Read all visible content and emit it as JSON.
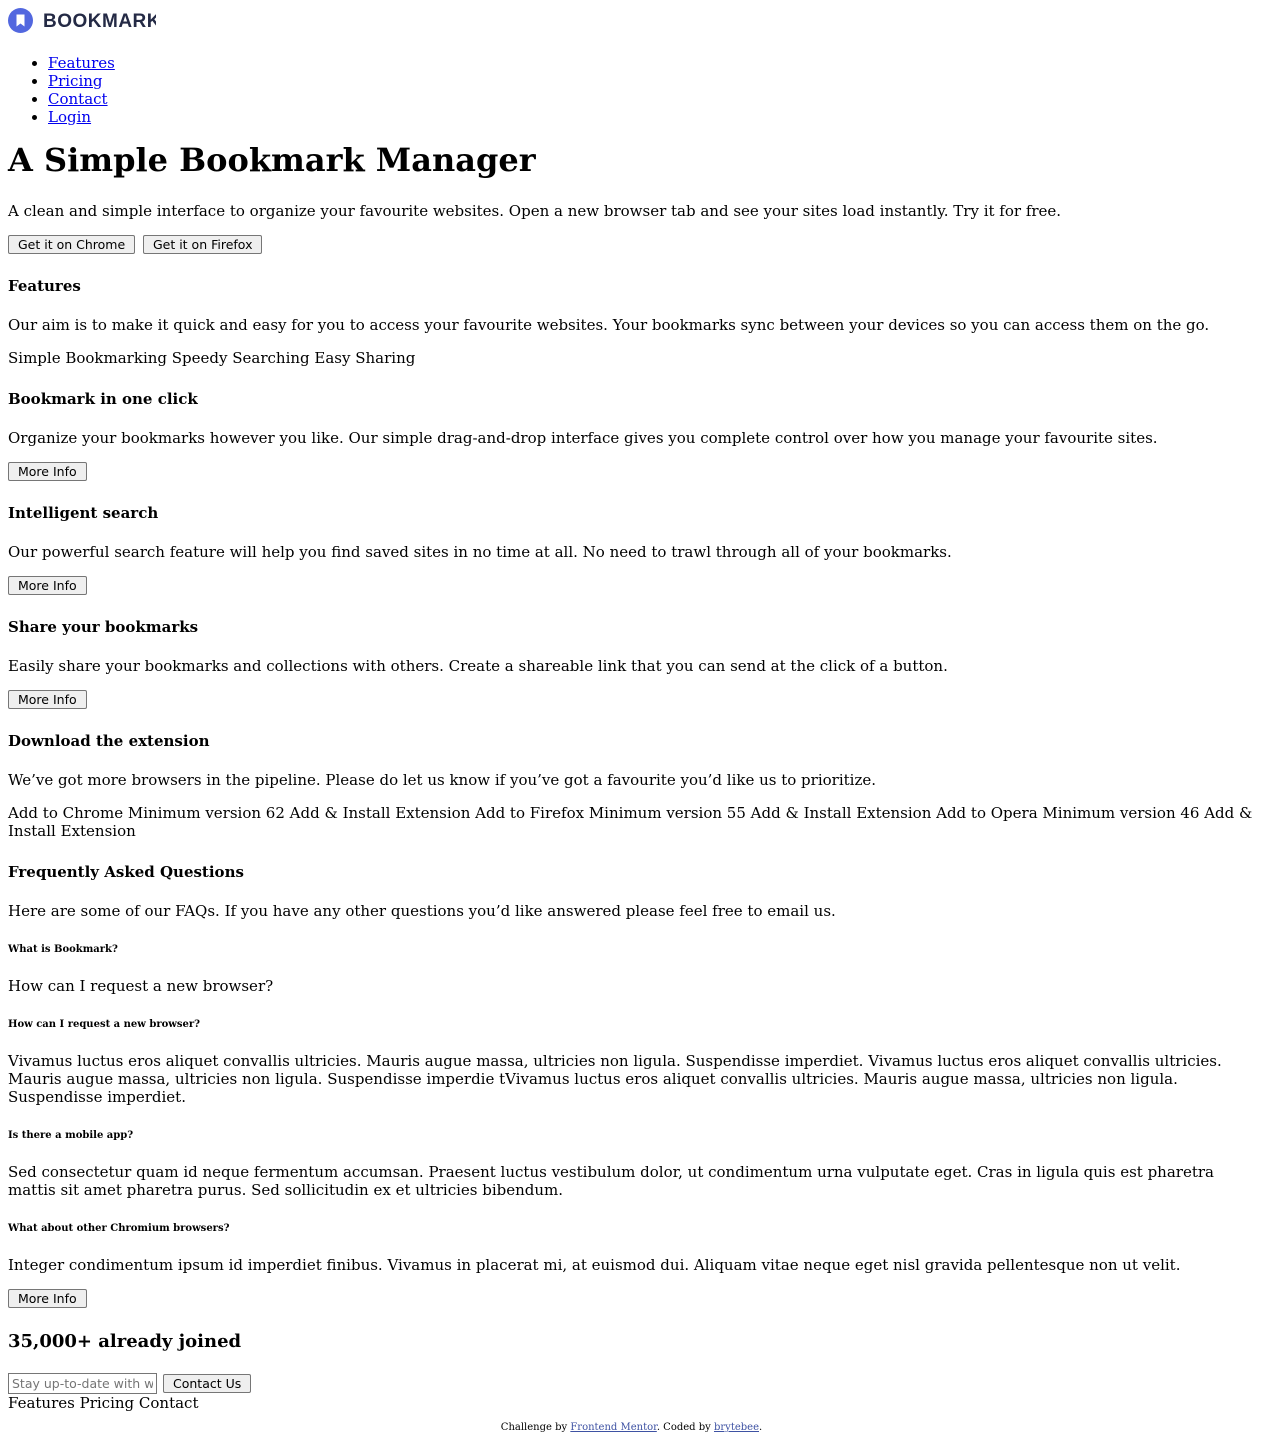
{
  "brand": {
    "name": "BOOKMARK",
    "color": "#5267df",
    "text_color": "#242a45"
  },
  "nav": {
    "items": [
      "Features",
      "Pricing",
      "Contact",
      "Login"
    ]
  },
  "hero": {
    "title": "A Simple Bookmark Manager",
    "text": "A clean and simple interface to organize your favourite websites. Open a new browser tab and see your sites load instantly. Try it for free.",
    "chrome_button": "Get it on Chrome",
    "firefox_button": "Get it on Firefox"
  },
  "features": {
    "title": "Features",
    "text": "Our aim is to make it quick and easy for you to access your favourite websites. Your bookmarks sync between your devices so you can access them on the go.",
    "tabs_line": "Simple Bookmarking Speedy Searching Easy Sharing",
    "items": [
      {
        "title": "Bookmark in one click",
        "text": "Organize your bookmarks however you like. Our simple drag-and-drop interface gives you complete control over how you manage your favourite sites.",
        "button": "More Info"
      },
      {
        "title": "Intelligent search",
        "text": "Our powerful search feature will help you find saved sites in no time at all. No need to trawl through all of your bookmarks.",
        "button": "More Info"
      },
      {
        "title": "Share your bookmarks",
        "text": "Easily share your bookmarks and collections with others. Create a shareable link that you can send at the click of a button.",
        "button": "More Info"
      }
    ]
  },
  "download": {
    "title": "Download the extension",
    "text": "We’ve got more browsers in the pipeline. Please do let us know if you’ve got a favourite you’d like us to prioritize.",
    "line": "Add to Chrome Minimum version 62 Add & Install Extension Add to Firefox Minimum version 55 Add & Install Extension Add to Opera Minimum version 46 Add & Install Extension"
  },
  "faq": {
    "title": "Frequently Asked Questions",
    "text": "Here are some of our FAQs. If you have any other questions you’d like answered please feel free to email us.",
    "q1": "What is Bookmark?",
    "p1": "How can I request a new browser?",
    "q2": "How can I request a new browser?",
    "p2": "Vivamus luctus eros aliquet convallis ultricies. Mauris augue massa, ultricies non ligula. Suspendisse imperdiet. Vivamus luctus eros aliquet convallis ultricies. Mauris augue massa, ultricies non ligula. Suspendisse imperdie tVivamus luctus eros aliquet convallis ultricies. Mauris augue massa, ultricies non ligula. Suspendisse imperdiet.",
    "q3": "Is there a mobile app?",
    "p3": "Sed consectetur quam id neque fermentum accumsan. Praesent luctus vestibulum dolor, ut condimentum urna vulputate eget. Cras in ligula quis est pharetra mattis sit amet pharetra purus. Sed sollicitudin ex et ultricies bibendum.",
    "q4": "What about other Chromium browsers?",
    "p4": "Integer condimentum ipsum id imperdiet finibus. Vivamus in placerat mi, at euismod dui. Aliquam vitae neque eget nisl gravida pellentesque non ut velit.",
    "button": "More Info"
  },
  "signup": {
    "title": "35,000+ already joined",
    "placeholder": "Stay up-to-date with what we're doing",
    "button": "Contact Us"
  },
  "footer": {
    "nav": "Features Pricing Contact",
    "attribution_prefix": "Challenge by ",
    "frontend_mentor": "Frontend Mentor",
    "coded_by": ". Coded by ",
    "author": "brytebee",
    "suffix": "."
  }
}
